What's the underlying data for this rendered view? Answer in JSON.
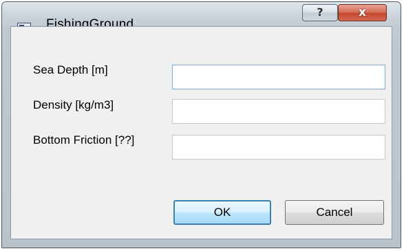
{
  "window": {
    "title": "FishingGround",
    "help_label": "?",
    "close_label": "x"
  },
  "form": {
    "fields": [
      {
        "label": "Sea Depth [m]",
        "value": ""
      },
      {
        "label": "Density [kg/m3]",
        "value": ""
      },
      {
        "label": "Bottom Friction [??]",
        "value": ""
      }
    ]
  },
  "buttons": {
    "ok_label": "OK",
    "cancel_label": "Cancel"
  },
  "icons": {
    "app": "app-window-icon",
    "help": "question-mark-icon",
    "close": "close-x-icon"
  },
  "colors": {
    "focus_border": "#7aa7d3",
    "default_button_border": "#3c7fb1",
    "close_button": "#c3482f"
  }
}
